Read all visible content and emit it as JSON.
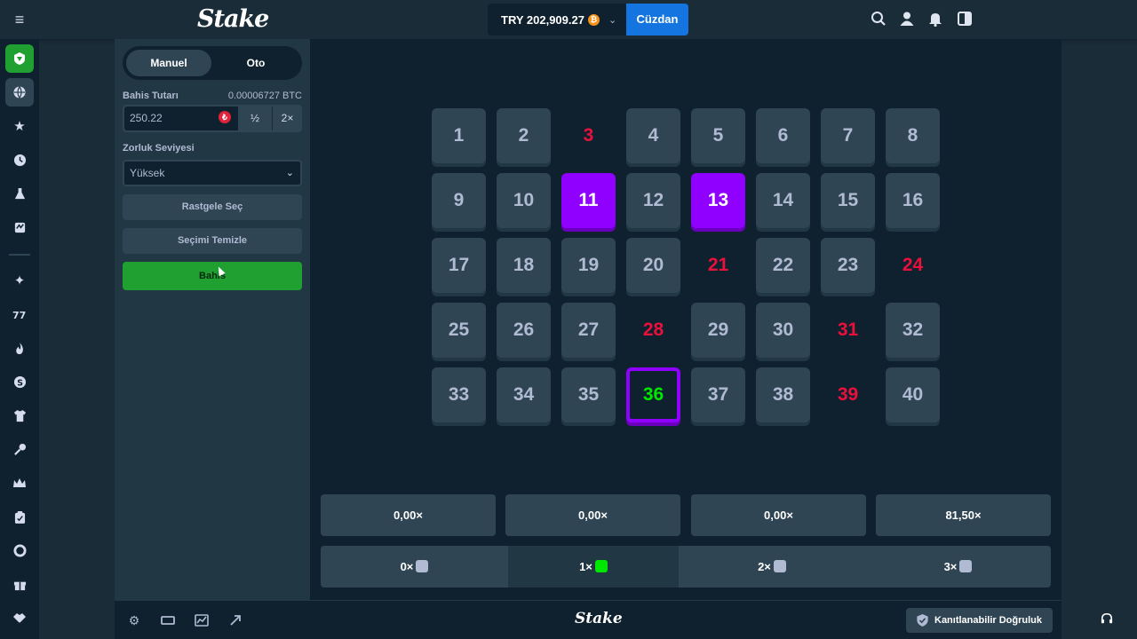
{
  "header": {
    "logo": "Stake",
    "balance": "TRY 202,909.27",
    "balance_coin": "₿",
    "wallet_label": "Cüzdan"
  },
  "bet_panel": {
    "tabs": [
      "Manuel",
      "Oto"
    ],
    "active_tab": "Manuel",
    "bet_amount_label": "Bahis Tutarı",
    "bet_amount_btc": "0.00006727 BTC",
    "bet_amount_value": "250.22",
    "currency_symbol": "₺",
    "half_label": "½",
    "double_label": "2×",
    "difficulty_label": "Zorluk Seviyesi",
    "difficulty_value": "Yüksek",
    "random_pick_label": "Rastgele Seç",
    "clear_label": "Seçimi Temizle",
    "bet_label": "Bahis"
  },
  "board": {
    "tiles": [
      {
        "n": "1",
        "state": "normal"
      },
      {
        "n": "2",
        "state": "normal"
      },
      {
        "n": "3",
        "state": "empty"
      },
      {
        "n": "4",
        "state": "normal"
      },
      {
        "n": "5",
        "state": "normal"
      },
      {
        "n": "6",
        "state": "normal"
      },
      {
        "n": "7",
        "state": "normal"
      },
      {
        "n": "8",
        "state": "normal"
      },
      {
        "n": "9",
        "state": "normal"
      },
      {
        "n": "10",
        "state": "normal"
      },
      {
        "n": "11",
        "state": "selected"
      },
      {
        "n": "12",
        "state": "normal"
      },
      {
        "n": "13",
        "state": "selected"
      },
      {
        "n": "14",
        "state": "normal"
      },
      {
        "n": "15",
        "state": "normal"
      },
      {
        "n": "16",
        "state": "normal"
      },
      {
        "n": "17",
        "state": "normal"
      },
      {
        "n": "18",
        "state": "normal"
      },
      {
        "n": "19",
        "state": "normal"
      },
      {
        "n": "20",
        "state": "normal"
      },
      {
        "n": "21",
        "state": "empty"
      },
      {
        "n": "22",
        "state": "normal"
      },
      {
        "n": "23",
        "state": "normal"
      },
      {
        "n": "24",
        "state": "empty"
      },
      {
        "n": "25",
        "state": "normal"
      },
      {
        "n": "26",
        "state": "normal"
      },
      {
        "n": "27",
        "state": "normal"
      },
      {
        "n": "28",
        "state": "empty"
      },
      {
        "n": "29",
        "state": "normal"
      },
      {
        "n": "30",
        "state": "normal"
      },
      {
        "n": "31",
        "state": "empty"
      },
      {
        "n": "32",
        "state": "normal"
      },
      {
        "n": "33",
        "state": "normal"
      },
      {
        "n": "34",
        "state": "normal"
      },
      {
        "n": "35",
        "state": "normal"
      },
      {
        "n": "36",
        "state": "hit"
      },
      {
        "n": "37",
        "state": "normal"
      },
      {
        "n": "38",
        "state": "normal"
      },
      {
        "n": "39",
        "state": "empty"
      },
      {
        "n": "40",
        "state": "normal"
      }
    ],
    "payouts": [
      "0,00×",
      "0,00×",
      "0,00×",
      "81,50×"
    ],
    "hits": [
      {
        "label": "0×",
        "gem": "gray",
        "active": false
      },
      {
        "label": "1×",
        "gem": "green",
        "active": true
      },
      {
        "label": "2×",
        "gem": "gray",
        "active": false
      },
      {
        "label": "3×",
        "gem": "gray",
        "active": false
      }
    ]
  },
  "footer": {
    "logo": "Stake",
    "fairness_label": "Kanıtlanabilir Doğruluk"
  },
  "colors": {
    "accent_purple": "#9000ff",
    "bet_green": "#1fa030",
    "wallet_blue": "#1475e1",
    "miss_red": "#e9113c",
    "hit_green": "#00e701"
  }
}
